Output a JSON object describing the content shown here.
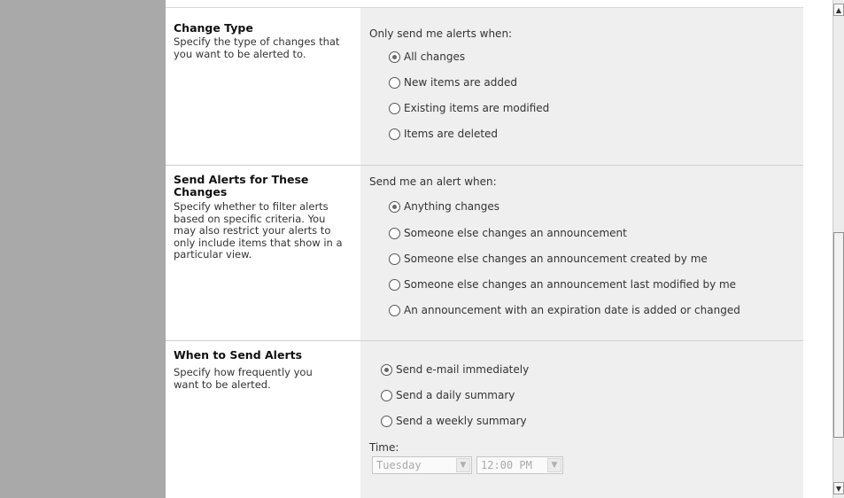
{
  "change_type": {
    "title": "Change Type",
    "description": "Specify the type of changes that you want to be alerted to.",
    "prompt": "Only send me alerts when:",
    "options": [
      "All changes",
      "New items are added",
      "Existing items are modified",
      "Items are deleted"
    ],
    "selected": "All changes"
  },
  "filter": {
    "title": "Send Alerts for These Changes",
    "description": "Specify whether to filter alerts based on specific criteria. You may also restrict your alerts to only include items that show in a particular view.",
    "prompt": "Send me an alert when:",
    "options": [
      "Anything changes",
      "Someone else changes an announcement",
      "Someone else changes an announcement created by me",
      "Someone else changes an announcement last modified by me",
      "An announcement with an expiration date is added or changed"
    ],
    "selected": "Anything changes"
  },
  "when": {
    "title": "When to Send Alerts",
    "description": "Specify how frequently you want to be alerted.",
    "options": [
      "Send e-mail immediately",
      "Send a daily summary",
      "Send a weekly summary"
    ],
    "selected": "Send e-mail immediately",
    "time_label": "Time:",
    "day_value": "Tuesday",
    "time_value": "12:00 PM"
  },
  "scrollbar": {
    "up_icon": "▲",
    "down_icon": "▼"
  }
}
